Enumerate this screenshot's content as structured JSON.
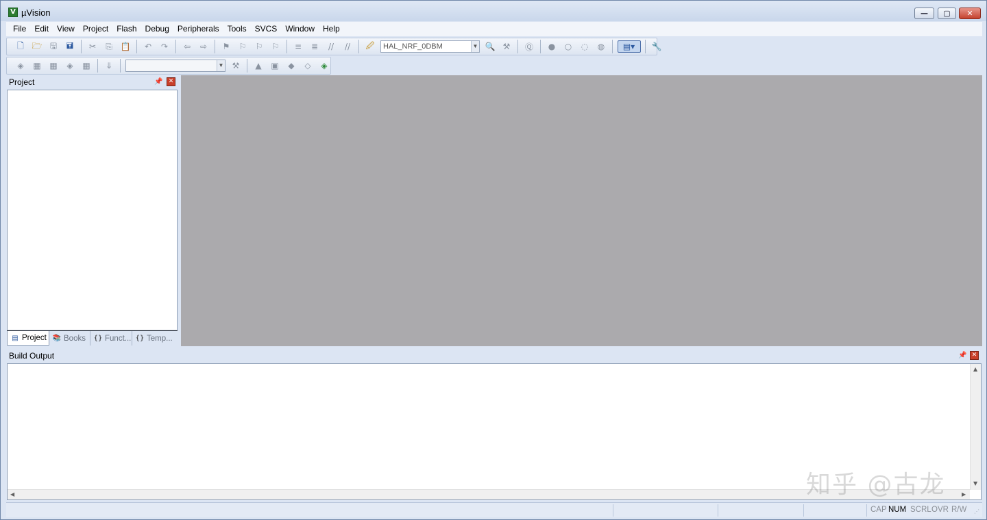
{
  "window": {
    "title": "µVision",
    "logo_letter": "V"
  },
  "menu": [
    "File",
    "Edit",
    "View",
    "Project",
    "Flash",
    "Debug",
    "Peripherals",
    "Tools",
    "SVCS",
    "Window",
    "Help"
  ],
  "toolbar": {
    "target_select": "HAL_NRF_0DBM",
    "second_select": ""
  },
  "project_panel": {
    "title": "Project",
    "tabs": [
      {
        "label": "Project",
        "icon": "project-window-icon"
      },
      {
        "label": "Books",
        "icon": "books-icon"
      },
      {
        "label": "Funct...",
        "icon": "functions-icon"
      },
      {
        "label": "Temp...",
        "icon": "templates-icon"
      }
    ]
  },
  "build_output": {
    "title": "Build Output"
  },
  "status": {
    "indicators": [
      {
        "label": "CAP",
        "active": false
      },
      {
        "label": "NUM",
        "active": true
      },
      {
        "label": "SCRL",
        "active": false
      },
      {
        "label": "OVR",
        "active": false
      },
      {
        "label": "R/W",
        "active": false
      }
    ]
  },
  "watermark": "知乎 @古龙",
  "colors": {
    "editor_background": "#abaaad",
    "frame": "#dce5f3",
    "close_red": "#c9402a"
  }
}
